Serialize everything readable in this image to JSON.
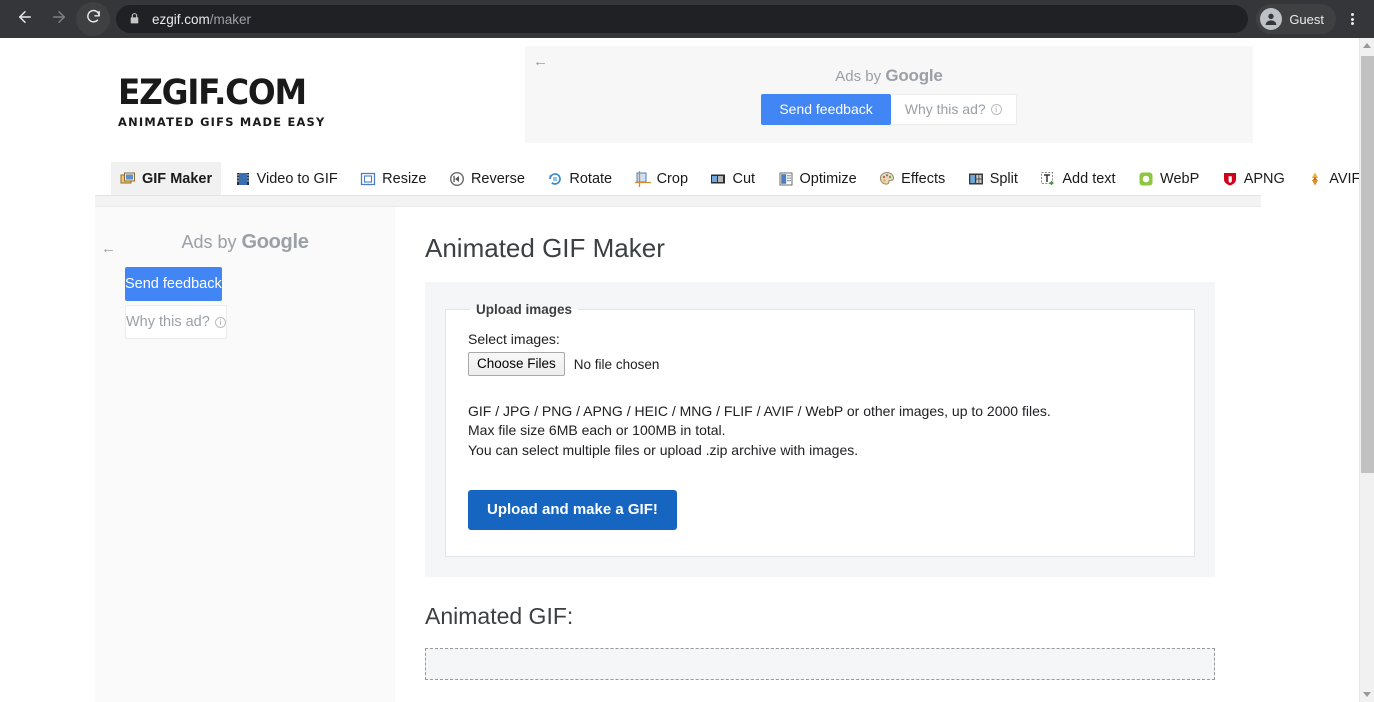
{
  "browser": {
    "back_icon": "back-arrow-icon",
    "forward_icon": "forward-arrow-icon",
    "reload_icon": "reload-icon",
    "lock_icon": "lock-icon",
    "url_host": "ezgif.com",
    "url_path": "/maker",
    "profile_label": "Guest",
    "menu_icon": "kebab-menu-icon"
  },
  "site": {
    "logo_main": "EZGIF.COM",
    "logo_sub": "ANIMATED GIFS MADE EASY"
  },
  "top_ad": {
    "back_arrow": "←",
    "ads_by_prefix": "Ads by ",
    "ads_by_brand": "Google",
    "send_feedback": "Send feedback",
    "why_this_ad": "Why this ad?",
    "info_glyph": "i"
  },
  "sidebar_ad": {
    "back_arrow": "←",
    "ads_by_prefix": "Ads by ",
    "ads_by_brand": "Google",
    "send_feedback": "Send feedback",
    "why_this_ad": "Why this ad?",
    "info_glyph": "i"
  },
  "nav": {
    "tabs": [
      {
        "label": "GIF Maker",
        "icon": "gif-maker-icon",
        "active": true
      },
      {
        "label": "Video to GIF",
        "icon": "video-to-gif-icon",
        "active": false
      },
      {
        "label": "Resize",
        "icon": "resize-icon",
        "active": false
      },
      {
        "label": "Reverse",
        "icon": "reverse-icon",
        "active": false
      },
      {
        "label": "Rotate",
        "icon": "rotate-icon",
        "active": false
      },
      {
        "label": "Crop",
        "icon": "crop-icon",
        "active": false
      },
      {
        "label": "Cut",
        "icon": "cut-icon",
        "active": false
      },
      {
        "label": "Optimize",
        "icon": "optimize-icon",
        "active": false
      },
      {
        "label": "Effects",
        "icon": "effects-icon",
        "active": false
      },
      {
        "label": "Split",
        "icon": "split-icon",
        "active": false
      },
      {
        "label": "Add text",
        "icon": "add-text-icon",
        "active": false
      },
      {
        "label": "WebP",
        "icon": "webp-icon",
        "active": false
      },
      {
        "label": "APNG",
        "icon": "apng-icon",
        "active": false
      },
      {
        "label": "AVIF",
        "icon": "avif-icon",
        "active": false
      }
    ]
  },
  "main": {
    "page_title": "Animated GIF Maker",
    "upload": {
      "legend": "Upload images",
      "select_label": "Select images:",
      "choose_files_button": "Choose Files",
      "file_status": "No file chosen",
      "help_line_1": "GIF / JPG / PNG / APNG / HEIC / MNG / FLIF / AVIF / WebP or other images, up to 2000 files.",
      "help_line_2": "Max file size 6MB each or 100MB in total.",
      "help_line_3": "You can select multiple files or upload .zip archive with images.",
      "submit_button": "Upload and make a GIF!"
    },
    "result": {
      "title": "Animated GIF:",
      "placeholder_value": ""
    }
  },
  "colors": {
    "accent_blue": "#1665c0",
    "google_blue": "#4285f4",
    "chrome_bg": "#35363a",
    "omnibox_bg": "#202124",
    "panel_gray": "#f5f6f7"
  }
}
